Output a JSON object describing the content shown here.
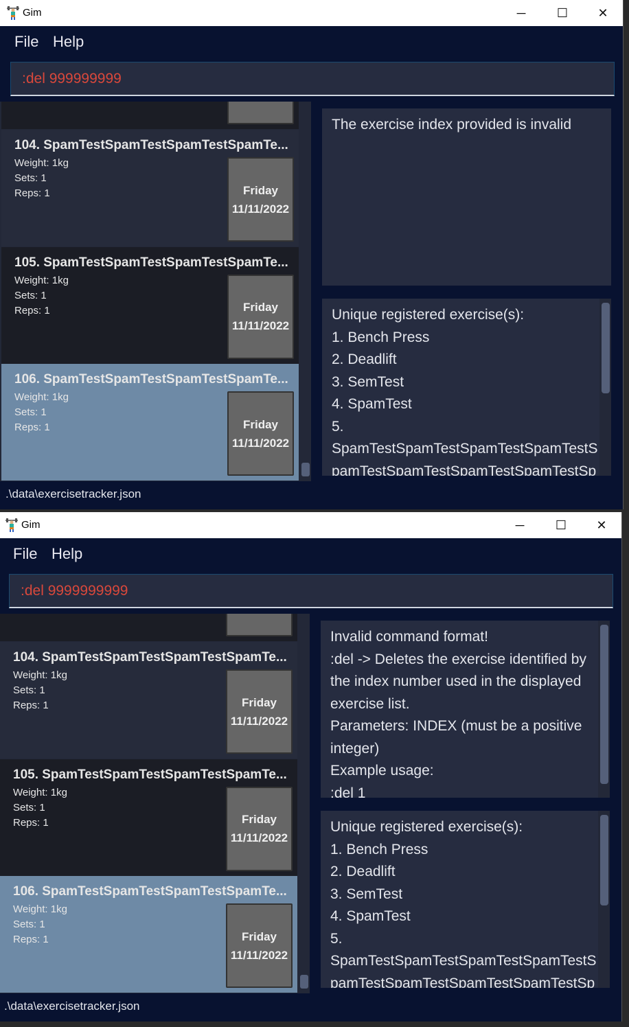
{
  "windows": [
    {
      "title": "Gim",
      "menu": [
        "File",
        "Help"
      ],
      "command": ":del 999999999",
      "result_lines": [
        "The exercise index provided is invalid"
      ],
      "result_scroll": false,
      "exercise_lines": [
        "Unique registered exercise(s):",
        "1. Bench Press",
        "2. Deadlift",
        "3. SemTest",
        "4. SpamTest",
        "5.",
        "SpamTestSpamTestSpamTestSpamTestS",
        "pamTestSpamTestSpamTestSpamTestSp"
      ],
      "status": ".\\data\\exercisetracker.json"
    },
    {
      "title": "Gim",
      "menu": [
        "File",
        "Help"
      ],
      "command": ":del 9999999999",
      "result_lines": [
        "Invalid command format!",
        ":del -> Deletes the exercise identified by",
        "the index number used in the displayed",
        "exercise list.",
        "Parameters: INDEX (must be a positive",
        "integer)",
        "Example usage:",
        ":del 1"
      ],
      "result_scroll": true,
      "exercise_lines": [
        "Unique registered exercise(s):",
        "1. Bench Press",
        "2. Deadlift",
        "3. SemTest",
        "4. SpamTest",
        "5.",
        "SpamTestSpamTestSpamTestSpamTestS",
        "pamTestSpamTestSpamTestSpamTestSp"
      ],
      "status": ".\\data\\exercisetracker.json"
    }
  ],
  "cards": [
    {
      "title": "104.  SpamTestSpamTestSpamTestSpamTe...",
      "weight": "Weight: 1kg",
      "sets": "Sets: 1",
      "reps": "Reps: 1",
      "day": "Friday",
      "date": "11/11/2022",
      "selected": false
    },
    {
      "title": "105.  SpamTestSpamTestSpamTestSpamTe...",
      "weight": "Weight: 1kg",
      "sets": "Sets: 1",
      "reps": "Reps: 1",
      "day": "Friday",
      "date": "11/11/2022",
      "selected": false
    },
    {
      "title": "106.  SpamTestSpamTestSpamTestSpamTe...",
      "weight": "Weight: 1kg",
      "sets": "Sets: 1",
      "reps": "Reps: 1",
      "day": "Friday",
      "date": "11/11/2022",
      "selected": true
    }
  ],
  "titlebar_buttons": {
    "minimize": "─",
    "maximize": "☐",
    "close": "✕"
  },
  "colors": {
    "background": "#081230",
    "card": "#262b3b",
    "card_alt": "#1b1d25",
    "selected": "#6e8aa6",
    "error_text": "#d9483b"
  }
}
